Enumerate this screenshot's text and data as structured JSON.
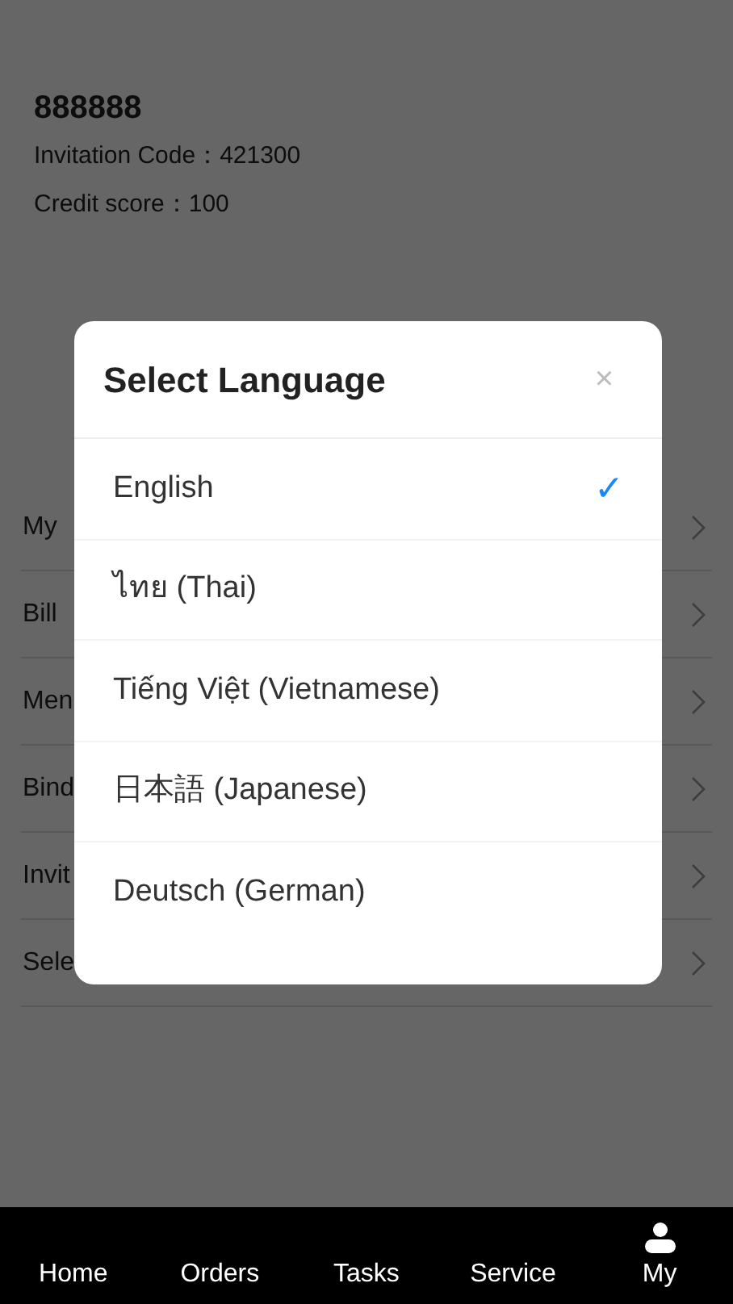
{
  "profile": {
    "name": "888888",
    "invitation_code": "Invitation Code：421300",
    "credit_score": "Credit score：100"
  },
  "menu": [
    "My",
    "Bill",
    "Men",
    "Bind",
    "Invit",
    "Sele"
  ],
  "dialog": {
    "title": "Select Language",
    "close": "×",
    "check": "✓",
    "options": [
      {
        "label": "English",
        "selected": true
      },
      {
        "label": "ไทย (Thai)",
        "selected": false
      },
      {
        "label": "Tiếng Việt (Vietnamese)",
        "selected": false
      },
      {
        "label": "日本語 (Japanese)",
        "selected": false
      },
      {
        "label": "Deutsch (German)",
        "selected": false
      }
    ]
  },
  "tab_bar": [
    {
      "label": "Home",
      "kind": "text"
    },
    {
      "label": "Orders",
      "kind": "text"
    },
    {
      "label": "Tasks",
      "kind": "text"
    },
    {
      "label": "Service",
      "kind": "text"
    },
    {
      "label": "My",
      "kind": "icon"
    }
  ]
}
